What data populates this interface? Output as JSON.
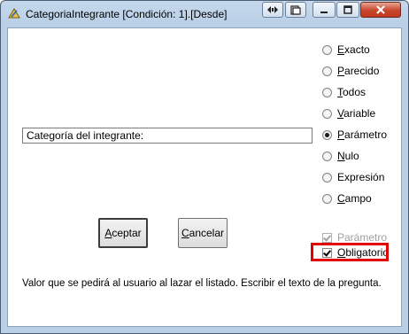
{
  "window": {
    "title": "CategoriaIntegrante [Condición: 1].[Desde]"
  },
  "titlebar_buttons": [
    {
      "name": "nav-arrows-button",
      "icon": "left-right-arrows-icon"
    },
    {
      "name": "pin-button",
      "icon": "pin-icon"
    },
    {
      "name": "minimize-button",
      "icon": "minimize-icon"
    },
    {
      "name": "maximize-button",
      "icon": "maximize-icon"
    },
    {
      "name": "close-button",
      "icon": "close-icon"
    }
  ],
  "question": {
    "value": "Categoría del integrante:"
  },
  "match_modes": {
    "selected": "Parámetro",
    "options": [
      {
        "first": "E",
        "rest": "xacto"
      },
      {
        "first": "P",
        "rest": "arecido"
      },
      {
        "first": "T",
        "rest": "odos"
      },
      {
        "first": "V",
        "rest": "ariable"
      },
      {
        "first": "P",
        "rest": "arámetro"
      },
      {
        "first": "N",
        "rest": "ulo"
      },
      {
        "first": "",
        "rest": "Expresión"
      },
      {
        "first": "C",
        "rest": "ampo"
      }
    ]
  },
  "buttons": {
    "accept": {
      "first": "A",
      "rest": "ceptar"
    },
    "cancel": {
      "first": "C",
      "rest": "ancelar"
    }
  },
  "checkboxes": {
    "parametro": {
      "label": "Parámetro",
      "checked": true,
      "enabled": false
    },
    "obligatorio": {
      "first": "O",
      "rest": "bligatorio",
      "checked": true,
      "enabled": true
    }
  },
  "hint": "Valor que se pedirá al usuario al lazar el listado. Escribir el texto de la pregunta.",
  "colors": {
    "highlight": "#e00000",
    "titlebar": "#c5d8ec",
    "close": "#c9462c"
  }
}
